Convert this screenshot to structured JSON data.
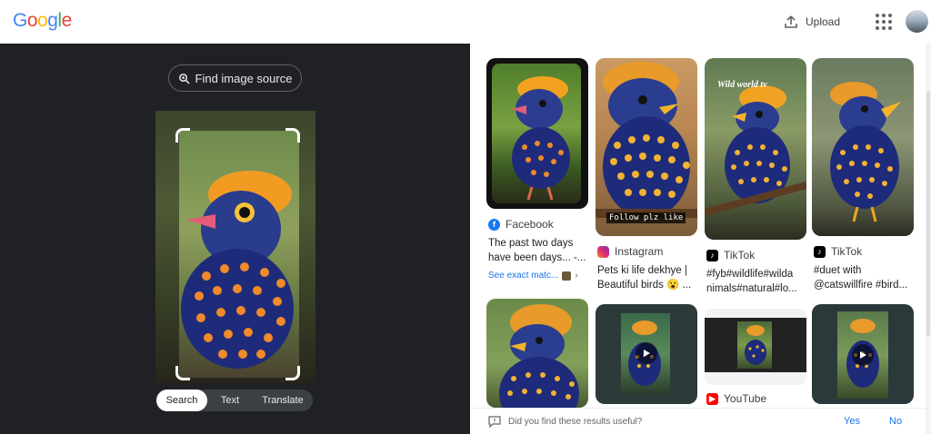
{
  "header": {
    "logo_letters": [
      "G",
      "o",
      "o",
      "g",
      "l",
      "e"
    ],
    "logo_colors": [
      "#4285f4",
      "#ea4335",
      "#fbbc05",
      "#4285f4",
      "#34a853",
      "#ea4335"
    ],
    "upload_label": "Upload",
    "upload_icon": "upload-icon",
    "apps_icon": "apps-grid-icon"
  },
  "lens": {
    "find_source_label": "Find image source",
    "modes": [
      {
        "label": "Search",
        "active": true
      },
      {
        "label": "Text",
        "active": false
      },
      {
        "label": "Translate",
        "active": false
      }
    ]
  },
  "results": [
    {
      "source": "Facebook",
      "source_color": "#1877f2",
      "caption": "The past two days have been days... -...",
      "see_exact": "See exact matc...",
      "overlay": ""
    },
    {
      "source": "Instagram",
      "source_color": "#e1306c",
      "caption": "Pets ki life dekhye | Beautiful birds 😮 ...",
      "overlay": "Follow plz like"
    },
    {
      "source": "TikTok",
      "source_color": "#000000",
      "caption": "#fyb#wildlife#wilda nimals#natural#lo...",
      "watermark": "Wild world tv"
    },
    {
      "source": "TikTok",
      "source_color": "#000000",
      "caption": "#duet with @catswillfire #bird..."
    },
    {
      "source": ""
    },
    {
      "source": ""
    },
    {
      "source": "YouTube",
      "source_color": "#ff0000"
    },
    {
      "source": ""
    }
  ],
  "feedback": {
    "question": "Did you find these results useful?",
    "yes": "Yes",
    "no": "No"
  },
  "colors": {
    "left_panel_bg": "#202124",
    "link_blue": "#1a73e8"
  }
}
